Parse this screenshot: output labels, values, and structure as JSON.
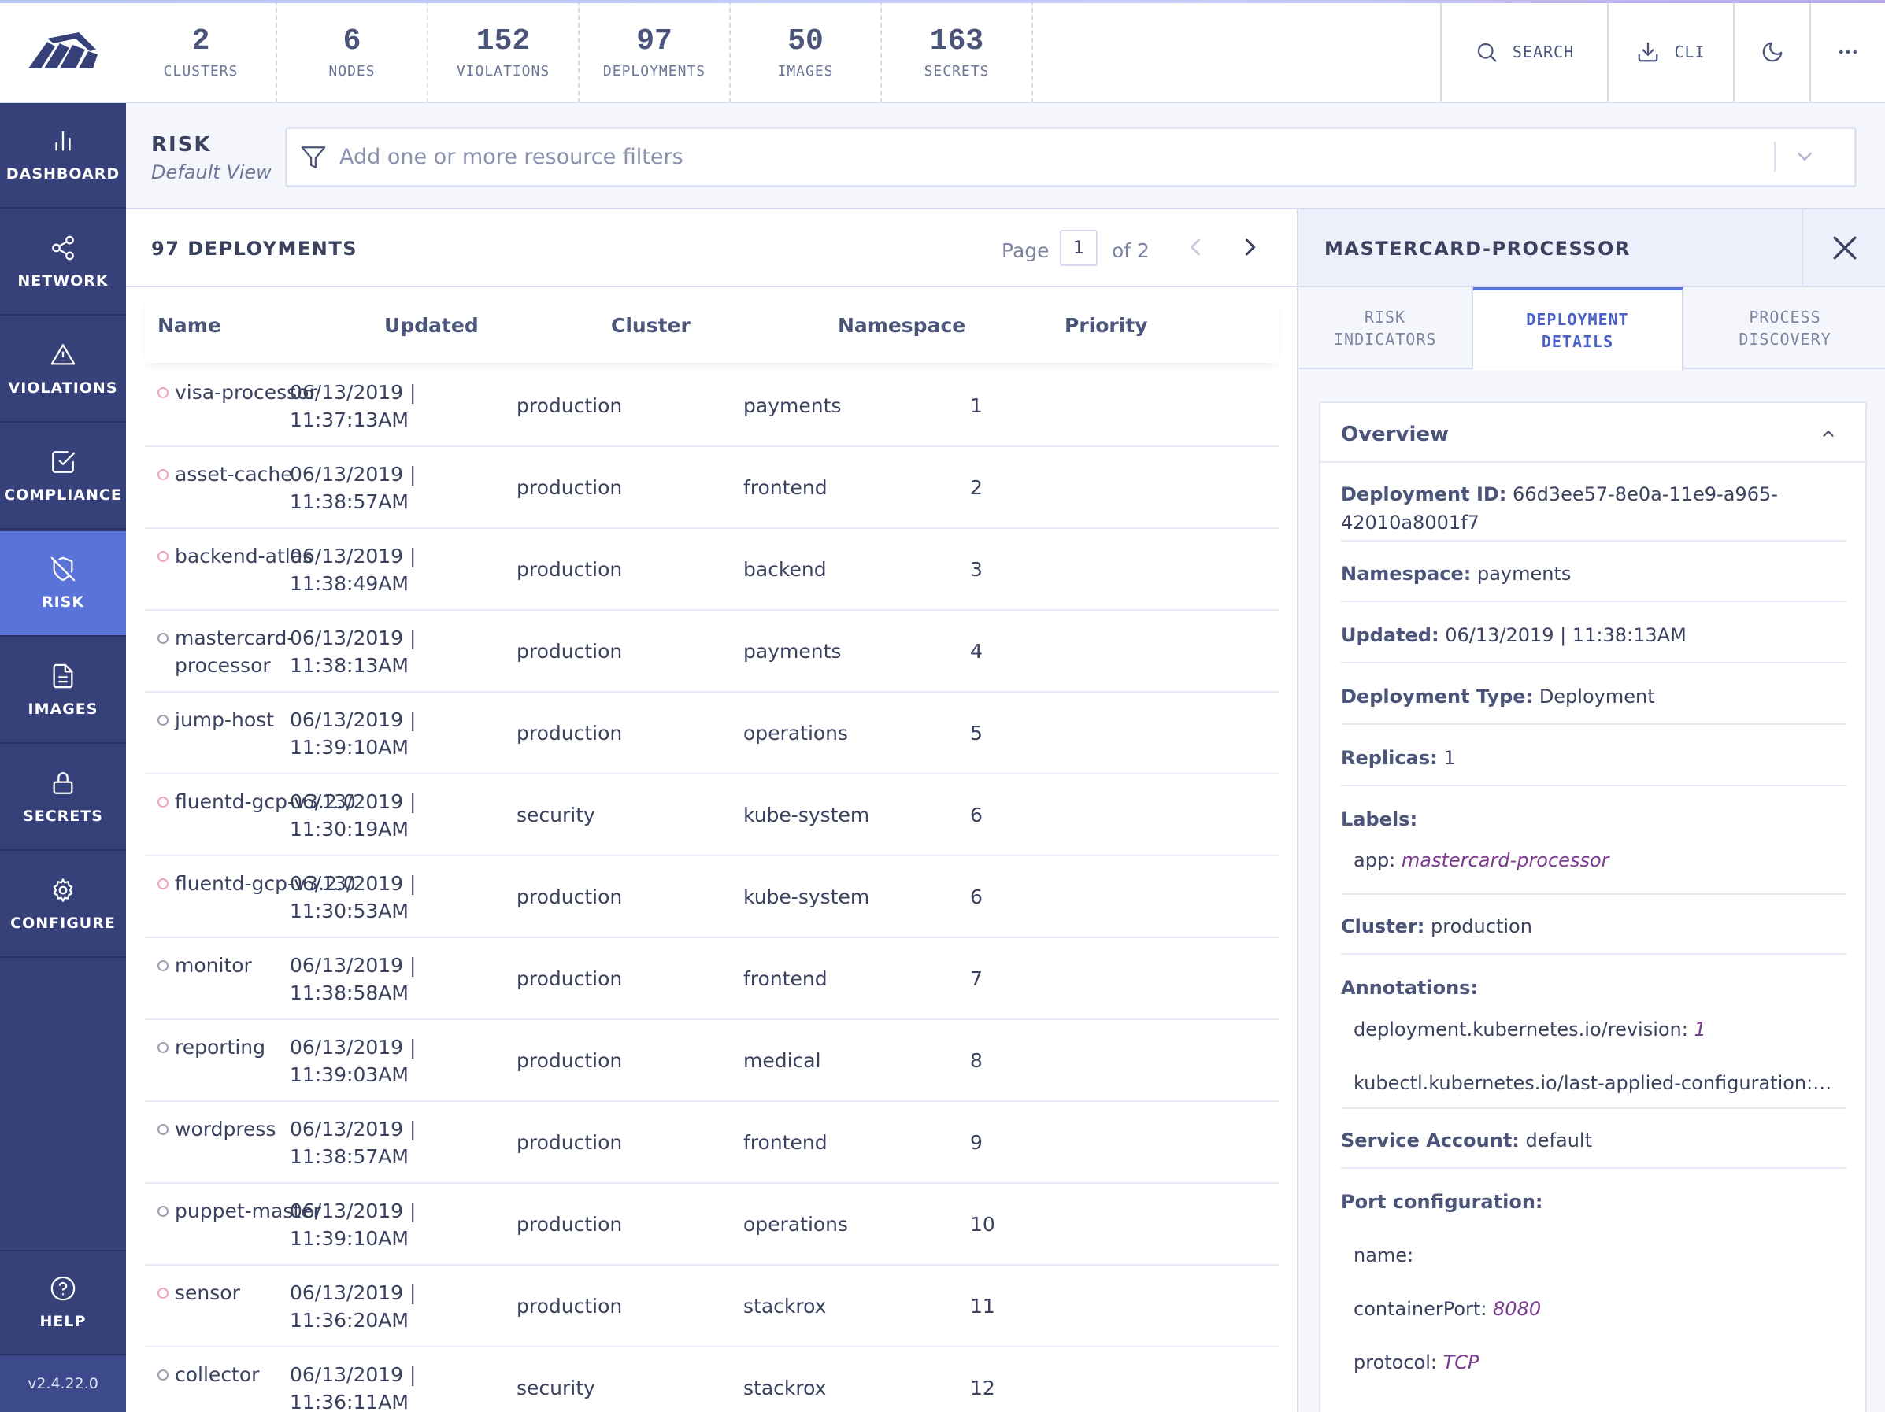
{
  "sidebar": {
    "logo_icon": "stackrox-logo",
    "items": [
      {
        "label": "DASHBOARD",
        "icon": "bar-chart-icon"
      },
      {
        "label": "NETWORK",
        "icon": "share-icon"
      },
      {
        "label": "VIOLATIONS",
        "icon": "alert-triangle-icon"
      },
      {
        "label": "COMPLIANCE",
        "icon": "check-square-icon"
      },
      {
        "label": "RISK",
        "icon": "shield-off-icon",
        "active": true
      },
      {
        "label": "IMAGES",
        "icon": "file-icon"
      },
      {
        "label": "SECRETS",
        "icon": "lock-icon"
      },
      {
        "label": "CONFIGURE",
        "icon": "gear-icon"
      }
    ],
    "help": {
      "label": "HELP",
      "icon": "help-circle-icon"
    },
    "version": "v2.4.22.0"
  },
  "summary": [
    {
      "count": "2",
      "label": "CLUSTERS"
    },
    {
      "count": "6",
      "label": "NODES"
    },
    {
      "count": "152",
      "label": "VIOLATIONS"
    },
    {
      "count": "97",
      "label": "DEPLOYMENTS"
    },
    {
      "count": "50",
      "label": "IMAGES"
    },
    {
      "count": "163",
      "label": "SECRETS"
    }
  ],
  "topbar": {
    "search_label": "SEARCH",
    "cli_label": "CLI",
    "icons": [
      "search-icon",
      "download-icon",
      "moon-icon",
      "more-icon"
    ]
  },
  "risk_header": {
    "title": "RISK",
    "subtitle": "Default View",
    "filter_placeholder": "Add one or more resource filters"
  },
  "deployments": {
    "title": "97 DEPLOYMENTS",
    "page_label": "Page",
    "page_current": "1",
    "page_of": "of 2",
    "columns": [
      "Name",
      "Updated",
      "Cluster",
      "Namespace",
      "Priority"
    ],
    "rows": [
      {
        "name": "visa-processor",
        "updated": "06/13/2019 | 11:37:13AM",
        "cluster": "production",
        "namespace": "payments",
        "priority": "1",
        "status": "danger"
      },
      {
        "name": "asset-cache",
        "updated": "06/13/2019 | 11:38:57AM",
        "cluster": "production",
        "namespace": "frontend",
        "priority": "2",
        "status": "danger"
      },
      {
        "name": "backend-atlas",
        "updated": "06/13/2019 | 11:38:49AM",
        "cluster": "production",
        "namespace": "backend",
        "priority": "3",
        "status": "danger"
      },
      {
        "name": "mastercard-processor",
        "updated": "06/13/2019 | 11:38:13AM",
        "cluster": "production",
        "namespace": "payments",
        "priority": "4",
        "status": "neutral"
      },
      {
        "name": "jump-host",
        "updated": "06/13/2019 | 11:39:10AM",
        "cluster": "production",
        "namespace": "operations",
        "priority": "5",
        "status": "neutral"
      },
      {
        "name": "fluentd-gcp-v3.2.0",
        "updated": "06/13/2019 | 11:30:19AM",
        "cluster": "security",
        "namespace": "kube-system",
        "priority": "6",
        "status": "danger"
      },
      {
        "name": "fluentd-gcp-v3.2.0",
        "updated": "06/13/2019 | 11:30:53AM",
        "cluster": "production",
        "namespace": "kube-system",
        "priority": "6",
        "status": "danger"
      },
      {
        "name": "monitor",
        "updated": "06/13/2019 | 11:38:58AM",
        "cluster": "production",
        "namespace": "frontend",
        "priority": "7",
        "status": "neutral"
      },
      {
        "name": "reporting",
        "updated": "06/13/2019 | 11:39:03AM",
        "cluster": "production",
        "namespace": "medical",
        "priority": "8",
        "status": "neutral"
      },
      {
        "name": "wordpress",
        "updated": "06/13/2019 | 11:38:57AM",
        "cluster": "production",
        "namespace": "frontend",
        "priority": "9",
        "status": "neutral"
      },
      {
        "name": "puppet-master",
        "updated": "06/13/2019 | 11:39:10AM",
        "cluster": "production",
        "namespace": "operations",
        "priority": "10",
        "status": "neutral"
      },
      {
        "name": "sensor",
        "updated": "06/13/2019 | 11:36:20AM",
        "cluster": "production",
        "namespace": "stackrox",
        "priority": "11",
        "status": "danger"
      },
      {
        "name": "collector",
        "updated": "06/13/2019 | 11:36:11AM",
        "cluster": "security",
        "namespace": "stackrox",
        "priority": "12",
        "status": "neutral"
      }
    ]
  },
  "detail": {
    "title": "MASTERCARD-PROCESSOR",
    "tabs": [
      "RISK INDICATORS",
      "DEPLOYMENT DETAILS",
      "PROCESS DISCOVERY"
    ],
    "active_tab": "DEPLOYMENT DETAILS",
    "overview": {
      "title": "Overview",
      "deployment_id_label": "Deployment ID:",
      "deployment_id": "66d3ee57-8e0a-11e9-a965-42010a8001f7",
      "namespace_label": "Namespace:",
      "namespace": "payments",
      "updated_label": "Updated:",
      "updated": "06/13/2019 | 11:38:13AM",
      "type_label": "Deployment Type:",
      "type": "Deployment",
      "replicas_label": "Replicas:",
      "replicas": "1",
      "labels_label": "Labels:",
      "labels": [
        {
          "key": "app:",
          "value": "mastercard-processor"
        }
      ],
      "cluster_label": "Cluster:",
      "cluster": "production",
      "annotations_label": "Annotations:",
      "annotations": [
        {
          "key": "deployment.kubernetes.io/revision:",
          "value": "1"
        },
        {
          "key": "kubectl.kubernetes.io/last-applied-configuration:",
          "value": "{\"..."
        }
      ],
      "service_account_label": "Service Account:",
      "service_account": "default",
      "port_config_label": "Port configuration:",
      "ports": [
        {
          "key": "name:",
          "value": ""
        },
        {
          "key": "containerPort:",
          "value": "8080"
        },
        {
          "key": "protocol:",
          "value": "TCP"
        }
      ]
    }
  },
  "colors": {
    "sidebar_bg": "#36417a",
    "sidebar_active": "#5a73d8",
    "accent_text": "#4a62c8",
    "danger_dot": "#f1a4b8",
    "label_value": "#7b3a8e"
  }
}
